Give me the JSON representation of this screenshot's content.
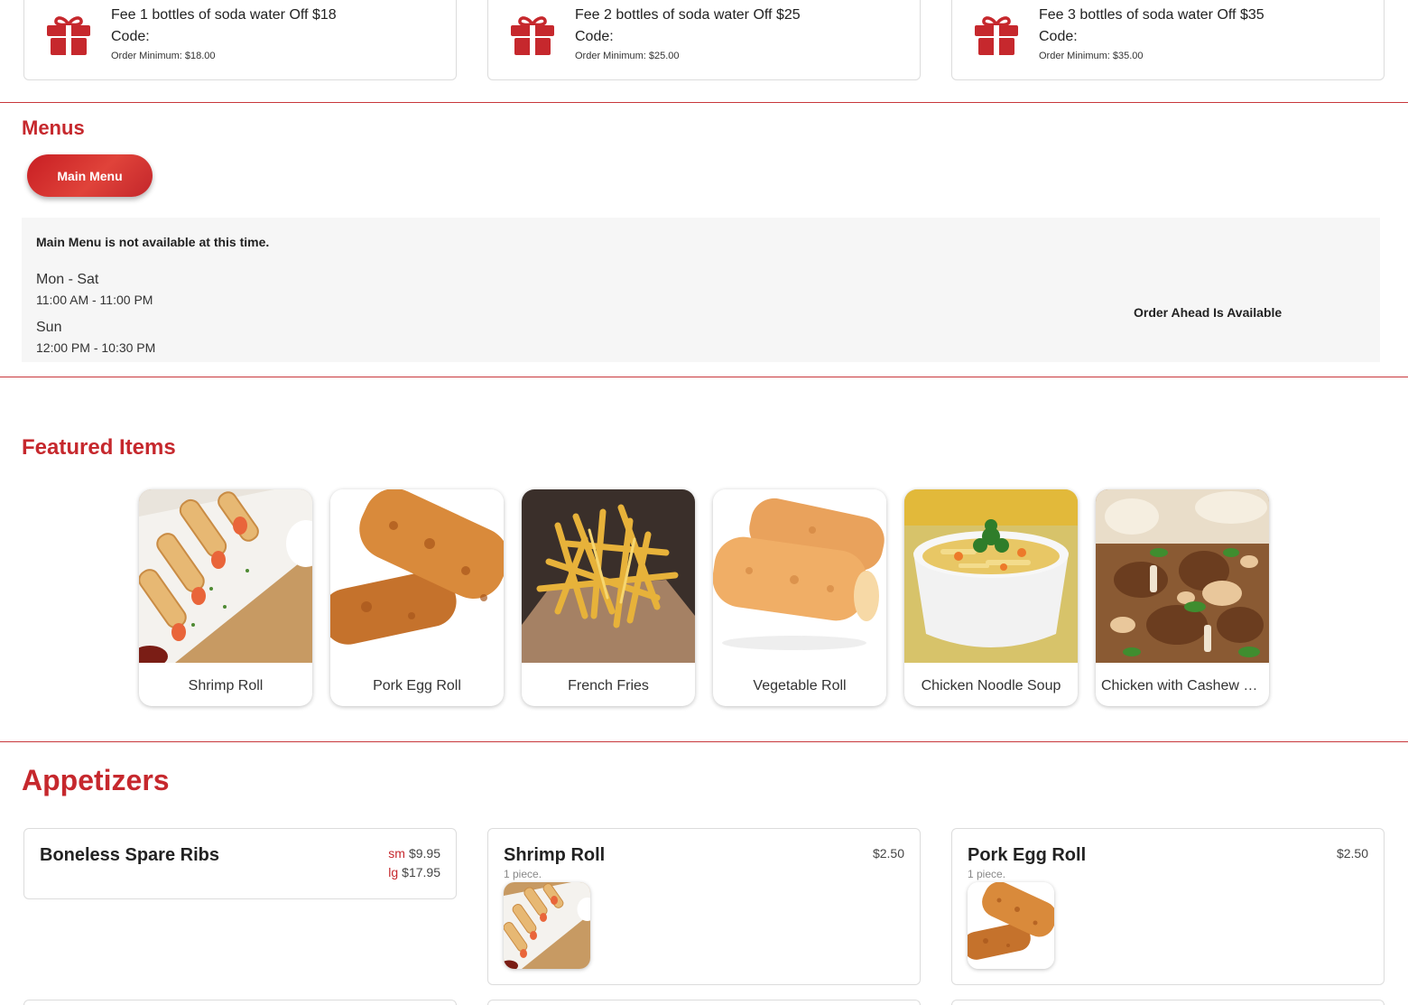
{
  "coupons": [
    {
      "title": "Fee 1 bottles of soda water Off $18",
      "code_label": "Code:",
      "minimum": "Order Minimum: $18.00"
    },
    {
      "title": "Fee 2 bottles of soda water Off $25",
      "code_label": "Code:",
      "minimum": "Order Minimum: $25.00"
    },
    {
      "title": "Fee 3 bottles of soda water Off $35",
      "code_label": "Code:",
      "minimum": "Order Minimum: $35.00"
    }
  ],
  "menus": {
    "title": "Menus",
    "button_label": "Main Menu",
    "unavailable_notice": "Main Menu is not available at this time.",
    "schedule": [
      {
        "days": "Mon - Sat",
        "hours": "11:00 AM - 11:00 PM"
      },
      {
        "days": "Sun",
        "hours": "12:00 PM - 10:30 PM"
      }
    ],
    "order_ahead": "Order Ahead Is Available"
  },
  "featured": {
    "title": "Featured Items",
    "items": [
      {
        "label": "Shrimp Roll"
      },
      {
        "label": "Pork Egg Roll"
      },
      {
        "label": "French Fries"
      },
      {
        "label": "Vegetable Roll"
      },
      {
        "label": "Chicken Noodle Soup"
      },
      {
        "label": "Chicken with Cashew Nuts"
      }
    ]
  },
  "appetizers": {
    "title": "Appetizers",
    "items": [
      {
        "name": "Boneless Spare Ribs",
        "prices": [
          {
            "size": "sm",
            "price": "$9.95"
          },
          {
            "size": "lg",
            "price": "$17.95"
          }
        ]
      },
      {
        "name": "Shrimp Roll",
        "price": "$2.50",
        "description": "1 piece."
      },
      {
        "name": "Pork Egg Roll",
        "price": "$2.50",
        "description": "1 piece."
      }
    ]
  },
  "colors": {
    "accent": "#c6282d",
    "panel": "#f6f6f6",
    "border": "#dcdcdc"
  },
  "icons": {
    "coupon": "gift-icon"
  }
}
